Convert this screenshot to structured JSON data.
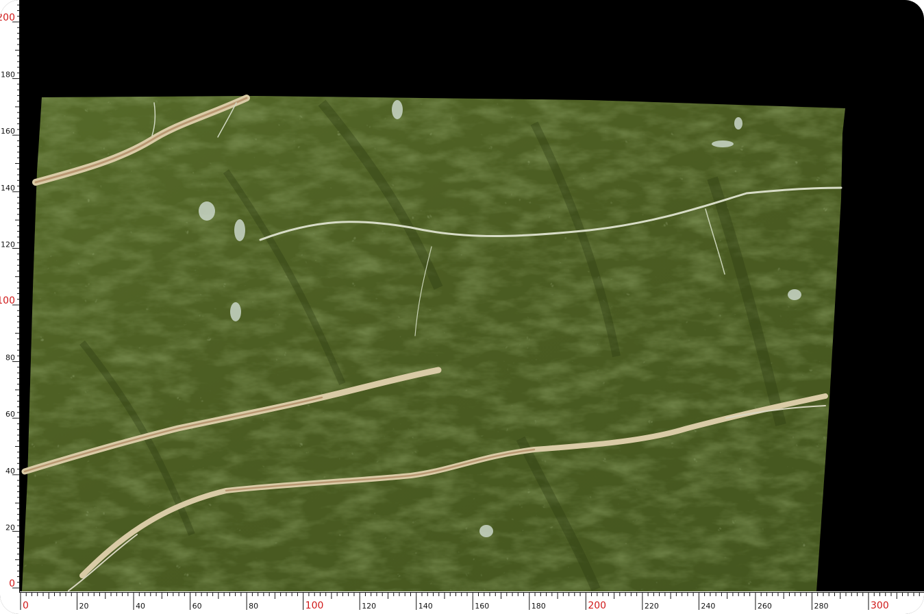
{
  "rulers": {
    "vertical": {
      "labels": [
        "0",
        "20",
        "40",
        "60",
        "80",
        "100",
        "120",
        "140",
        "160",
        "180",
        "200"
      ],
      "major": [
        "0",
        "100",
        "200"
      ],
      "minor_step": 2
    },
    "horizontal": {
      "labels": [
        "0",
        "20",
        "40",
        "60",
        "80",
        "100",
        "120",
        "140",
        "160",
        "180",
        "200",
        "220",
        "240",
        "260",
        "280",
        "300"
      ],
      "major": [
        "0",
        "100",
        "200",
        "300"
      ],
      "minor_step": 2
    }
  },
  "colors": {
    "background": "#000000",
    "ruler": "#ffffff",
    "tick": "#111111",
    "major_label": "#d01818",
    "slab_base": "#4a5a22",
    "vein": "#d8ccaa"
  },
  "slab": {
    "material": "green-marble-slab"
  }
}
